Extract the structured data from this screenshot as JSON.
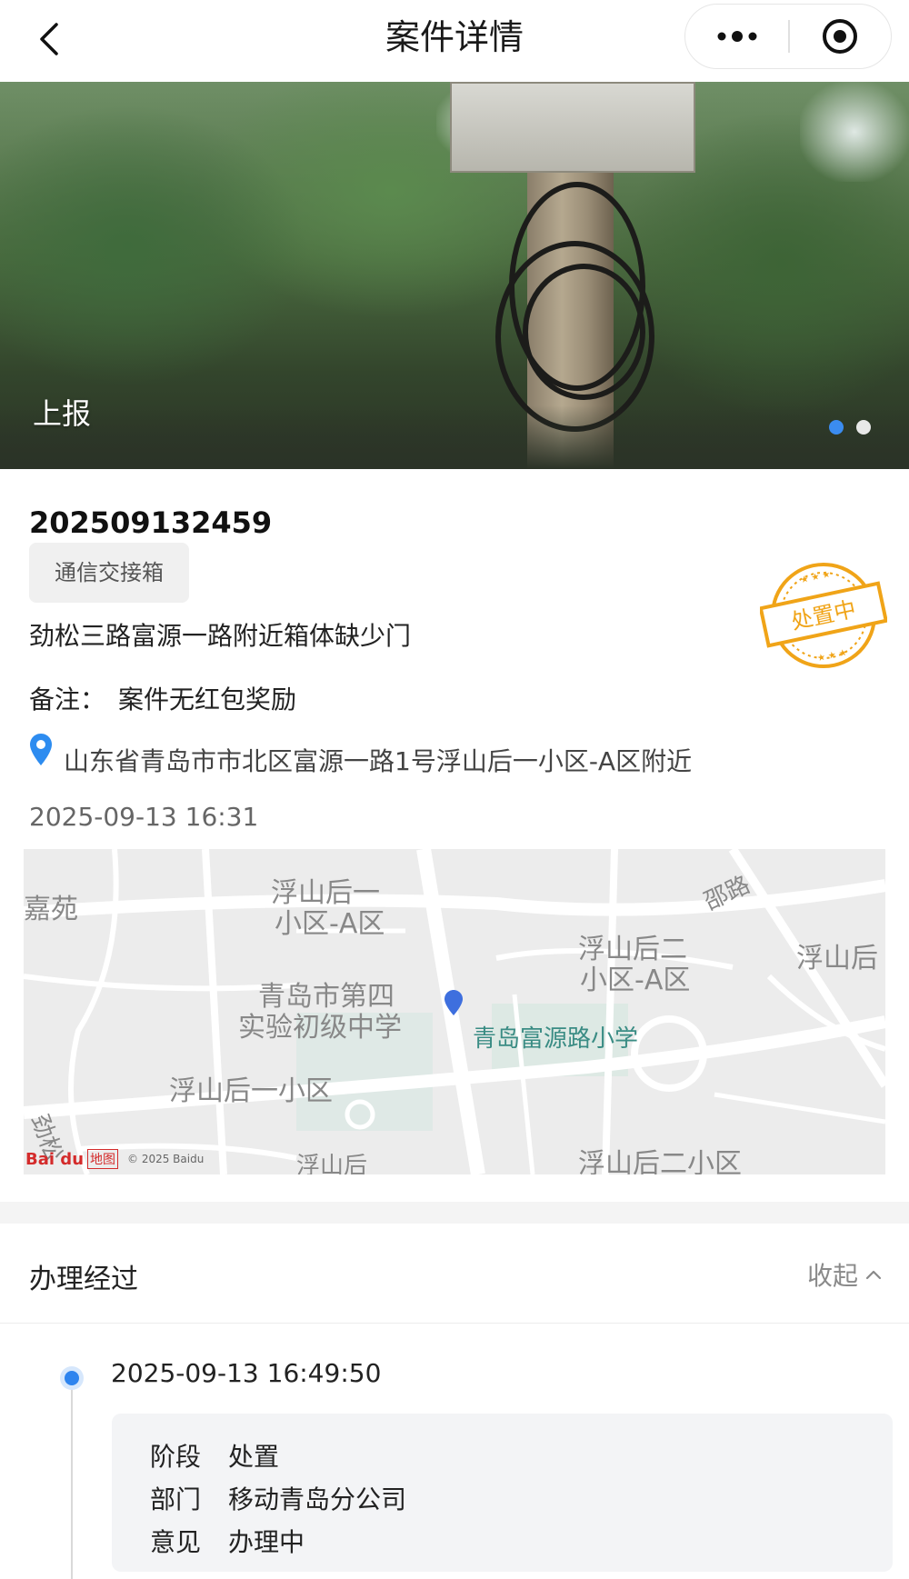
{
  "header": {
    "title": "案件详情"
  },
  "banner": {
    "label": "上报",
    "slides": 2,
    "active_slide": 1
  },
  "case": {
    "id": "202509132459",
    "category": "通信交接箱",
    "description": "劲松三路富源一路附近箱体缺少门",
    "remark_label": "备注：",
    "remark_value": "案件无红包奖励",
    "address": "山东省青岛市市北区富源一路1号浮山后一小区-A区附近",
    "datetime": "2025-09-13 16:31",
    "stamp_text": "处置中"
  },
  "map": {
    "labels": {
      "l1": "浮山后一",
      "l1b": "小区-A区",
      "l2": "浮山后二",
      "l2b": "小区-A区",
      "l3": "浮山后",
      "l4": "青岛市第四",
      "l4b": "实验初级中学",
      "l5": "青岛富源路小学",
      "l6": "浮山后一小区",
      "l7": "嘉苑",
      "l8": "劲松",
      "l9": "邵路",
      "l10": "浮山后",
      "l11": "浮山后二小区"
    },
    "logo_text": "Bai du",
    "logo_map": "地图",
    "copyright": "© 2025 Baidu"
  },
  "process": {
    "title": "办理经过",
    "collapse_label": "收起",
    "entries": [
      {
        "time": "2025-09-13 16:49:50",
        "stage_key": "阶段",
        "stage_value": "处置",
        "dept_key": "部门",
        "dept_value": "移动青岛分公司",
        "opinion_key": "意见",
        "opinion_value": "办理中"
      }
    ]
  },
  "colors": {
    "accent": "#2e84ee",
    "stamp": "#f0a418"
  }
}
